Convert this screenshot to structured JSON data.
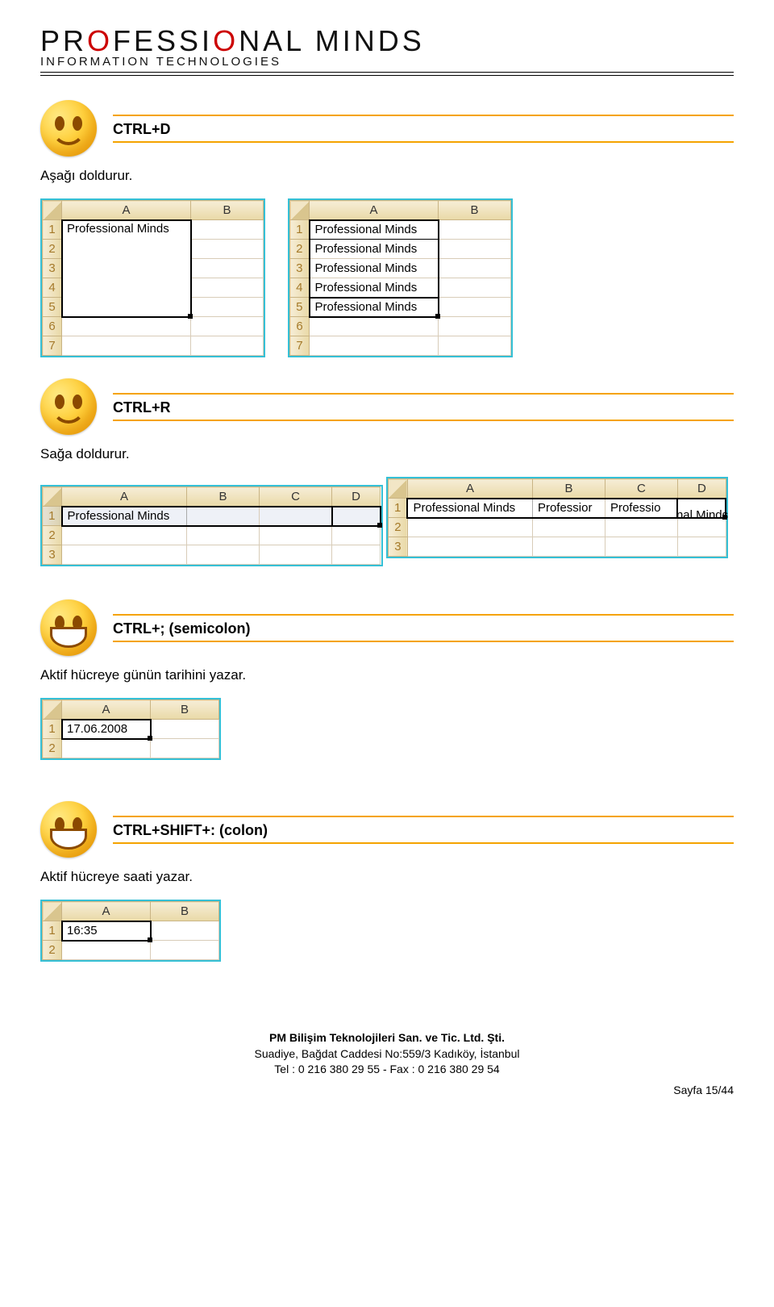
{
  "logo": {
    "line1_a": "PR",
    "line1_b": "O",
    "line1_c": "FESSI",
    "line1_d": "O",
    "line1_e": "NAL MINDS",
    "line2": "INFORMATION TECHNOLOGIES"
  },
  "sections": [
    {
      "title": "CTRL+D",
      "desc": "Aşağı doldurur.",
      "smile": "smile"
    },
    {
      "title": "CTRL+R",
      "desc": "Sağa doldurur.",
      "smile": "smile"
    },
    {
      "title": "CTRL+; (semicolon)",
      "desc": "Aktif hücreye günün tarihini yazar.",
      "smile": "grin"
    },
    {
      "title": "CTRL+SHIFT+: (colon)",
      "desc": "Aktif hücreye saati yazar.",
      "smile": "grin"
    }
  ],
  "cols": {
    "A": "A",
    "B": "B",
    "C": "C",
    "D": "D"
  },
  "rows": [
    "1",
    "2",
    "3",
    "4",
    "5",
    "6",
    "7"
  ],
  "pm_text": "Professional Minds",
  "sheet3_row1": {
    "A": "Professional Minds",
    "B": "",
    "C": "",
    "D": ""
  },
  "sheet4_row1": {
    "A": "Professional Minds",
    "B": "Professior",
    "C": "Professio",
    "D_overflow": "nal Minds"
  },
  "sheet5_val": "17.06.2008",
  "sheet6_val": "16:35",
  "footer": {
    "l1": "PM Bilişim Teknolojileri San. ve Tic. Ltd. Şti.",
    "l2": "Suadiye, Bağdat Caddesi No:559/3 Kadıköy, İstanbul",
    "l3": "Tel : 0 216 380 29 55  -  Fax : 0 216 380 29 54",
    "page": "Sayfa 15/44"
  }
}
